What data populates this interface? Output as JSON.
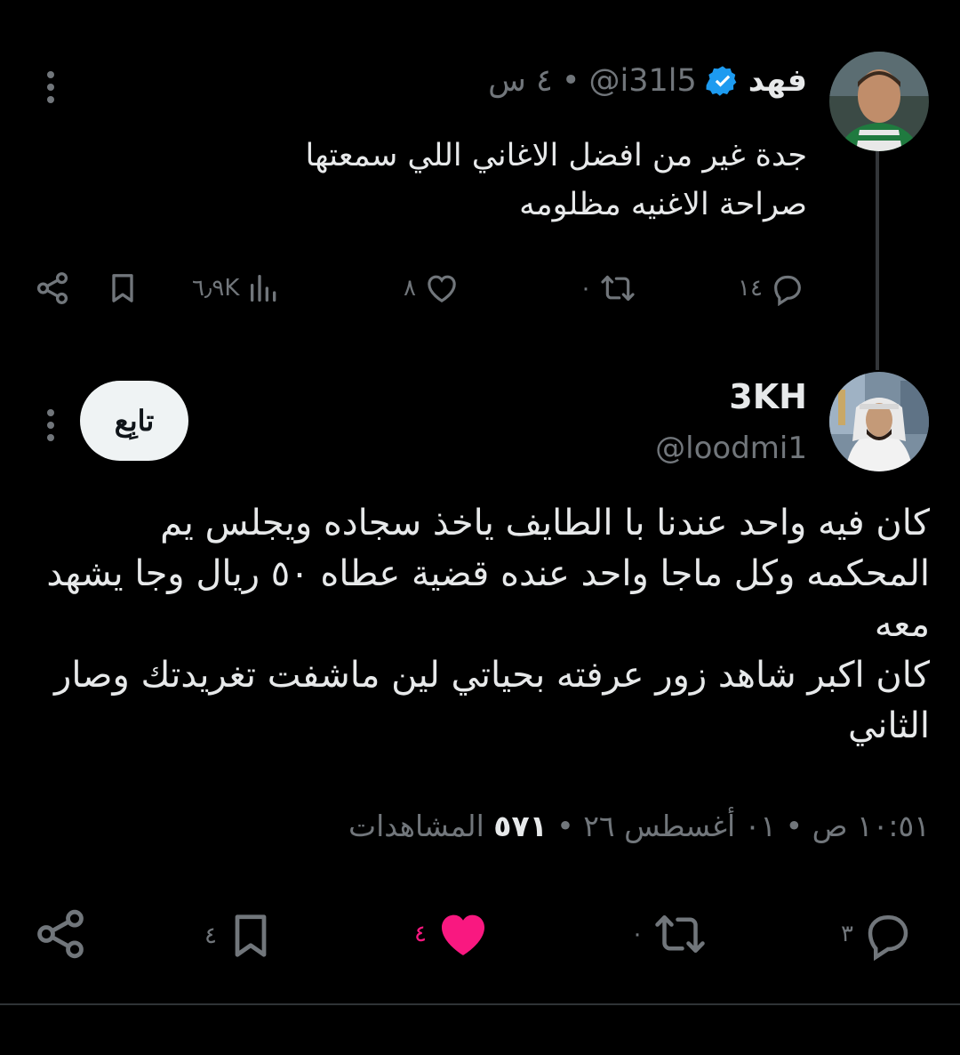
{
  "parent_tweet": {
    "name": "فهد",
    "handle": "@i31l5",
    "separator": "•",
    "time": "٤ س",
    "text_lines": [
      "جدة غير من افضل الاغاني اللي سمعتها",
      "صراحة الاغنيه مظلومه"
    ],
    "actions": {
      "replies": "١٤",
      "reposts": "٠",
      "likes": "٨",
      "views": "٦٫٩K"
    }
  },
  "reply_tweet": {
    "name": "3KH",
    "handle": "@loodmi1",
    "follow_label": "تابِع",
    "text_lines": [
      "كان فيه واحد عندنا با الطايف ياخذ سجاده ويجلس يم",
      "المحكمه وكل ماجا واحد عنده قضية عطاه ٥٠ ريال وجا يشهد",
      "معه",
      "كان اكبر شاهد زور عرفته بحياتي لين ماشفت تغريدتك وصار",
      "الثاني"
    ],
    "meta": {
      "time": "١٠:٥١ ص",
      "date": "٠١ أغسطس ٢٦",
      "views_count": "٥٧١",
      "views_label": "المشاهدات",
      "separator": "•"
    },
    "actions": {
      "replies": "٣",
      "reposts": "٠",
      "likes": "٤",
      "bookmarks": "٤"
    }
  },
  "colors": {
    "background": "#000000",
    "text": "#e7e9ea",
    "muted": "#71767b",
    "like_active": "#f91880",
    "verified": "#1d9bf0",
    "follow_bg": "#eff3f4"
  },
  "icons": [
    "reply-icon",
    "repost-icon",
    "like-icon",
    "views-icon",
    "bookmark-icon",
    "share-icon",
    "verified-icon",
    "more-icon"
  ]
}
